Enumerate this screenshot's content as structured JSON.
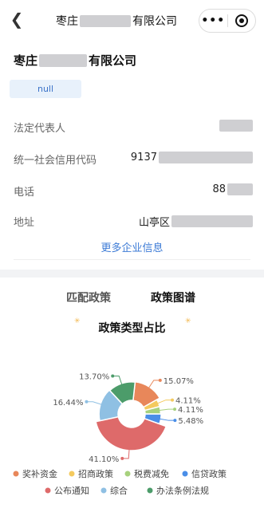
{
  "nav": {
    "back_icon": "back-arrow-icon",
    "title_prefix": "枣庄",
    "title_suffix": "有限公司",
    "more_icon": "more-dots-icon",
    "close_icon": "close-target-icon"
  },
  "company": {
    "name_prefix": "枣庄",
    "name_suffix": "有限公司",
    "badge": "null",
    "rows": [
      {
        "label": "法定代表人",
        "value": ""
      },
      {
        "label": "统一社会信用代码",
        "value": "9137"
      },
      {
        "label": "电话",
        "value": "88"
      },
      {
        "label": "地址",
        "value": "山亭区"
      }
    ],
    "more_link": "更多企业信息"
  },
  "tabs": [
    "匹配政策",
    "政策图谱"
  ],
  "chart_data": {
    "type": "pie",
    "title": "政策类型占比",
    "series": [
      {
        "name": "奖补资金",
        "value": 15.07,
        "label": "15.07%",
        "color": "#e8875a"
      },
      {
        "name": "招商政策",
        "value": 4.11,
        "label": "4.11%",
        "color": "#f4ca5e"
      },
      {
        "name": "税费减免",
        "value": 4.11,
        "label": "4.11%",
        "color": "#a7d17d"
      },
      {
        "name": "信贷政策",
        "value": 5.48,
        "label": "5.48%",
        "color": "#4a8ee8"
      },
      {
        "name": "公布通知",
        "value": 41.1,
        "label": "41.10%",
        "color": "#de6a6a"
      },
      {
        "name": "综合",
        "value": 16.44,
        "label": "16.44%",
        "color": "#8fc0e3"
      },
      {
        "name": "办法条例法规",
        "value": 13.7,
        "label": "13.70%",
        "color": "#4c9c6a"
      }
    ],
    "legend_position": "bottom"
  }
}
